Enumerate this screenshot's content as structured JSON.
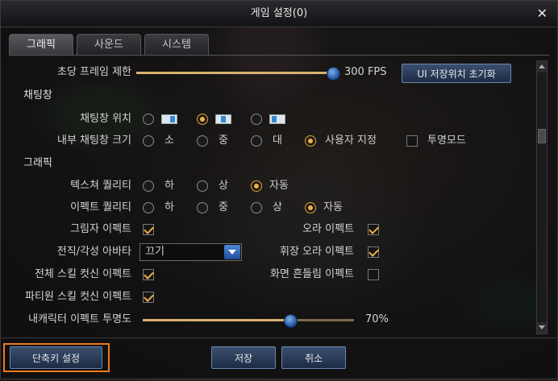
{
  "window": {
    "title": "게임 설정(0)"
  },
  "tabs": [
    {
      "label": "그래픽",
      "active": true
    },
    {
      "label": "사운드",
      "active": false
    },
    {
      "label": "시스템",
      "active": false
    }
  ],
  "frame_limit": {
    "label": "초당 프레임 제한",
    "value_text": "300 FPS",
    "level": 1.0,
    "reset_button": "UI 저장위치 초기화"
  },
  "chat_section": {
    "title": "채팅창",
    "position": {
      "label": "채팅창 위치",
      "selected_index": 1
    },
    "size": {
      "label": "내부 채팅창 크기",
      "options": [
        "소",
        "중",
        "대",
        "사용자 지정"
      ],
      "selected": "사용자 지정",
      "transparent_label": "투명모드",
      "transparent_checked": false
    }
  },
  "graphics_section": {
    "title": "그래픽",
    "texture_quality": {
      "label": "텍스쳐 퀄리티",
      "options": [
        "하",
        "상",
        "자동"
      ],
      "selected": "자동"
    },
    "effect_quality": {
      "label": "이펙트 퀄리티",
      "options": [
        "하",
        "중",
        "상",
        "자동"
      ],
      "selected": "자동"
    },
    "shadow_effect": {
      "label": "그림자 이펙트",
      "checked": true
    },
    "aura_effect": {
      "label": "오라 이펙트",
      "checked": true
    },
    "avatar": {
      "label": "전직/각성 아바타",
      "selected": "끄기"
    },
    "emblem_aura": {
      "label": "휘장 오라 이펙트",
      "checked": true
    },
    "skill_cutin_all": {
      "label": "전체 스킬 컷신 이펙트",
      "checked": true
    },
    "screen_shake": {
      "label": "화면 흔들림 이펙트",
      "checked": false
    },
    "skill_cutin_party": {
      "label": "파티원 스킬 컷신 이펙트",
      "checked": true
    },
    "my_effect_transparency": {
      "label": "내캐릭터 이펙트 투명도",
      "value_text": "70%",
      "level": 0.7
    }
  },
  "bottom": {
    "hotkey_button": "단축키 설정",
    "save_button": "저장",
    "cancel_button": "취소"
  },
  "colors": {
    "accent_orange": "#f07a1e",
    "radio_selected": "#f4b142",
    "button_blue": "#3a4f6e"
  }
}
